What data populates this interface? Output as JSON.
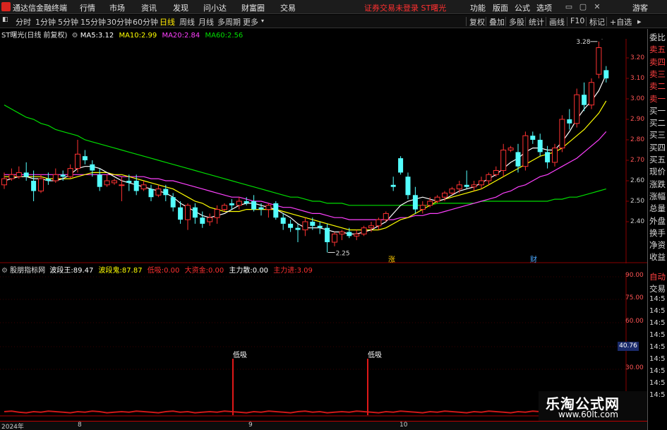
{
  "menubar": {
    "app_name": "通达信金融终端",
    "items": [
      "行情",
      "市场",
      "资讯",
      "发现",
      "问小达",
      "财富圈",
      "交易"
    ],
    "status": "证券交易未登录  ST曙光",
    "right_items": [
      "功能",
      "版面",
      "公式",
      "选项"
    ],
    "guest": "游客"
  },
  "periodbar": {
    "periods": [
      "分时",
      "1分钟",
      "5分钟",
      "15分钟",
      "30分钟",
      "60分钟",
      "日线",
      "周线",
      "月线",
      "多周期",
      "更多"
    ],
    "active": "日线",
    "tools": [
      "复权",
      "叠加",
      "多股",
      "统计",
      "画线",
      "F10",
      "标记",
      "+自选"
    ]
  },
  "main_info": {
    "stock": "ST曙光(日线 前复权)",
    "ma5_label": "MA5:",
    "ma5": "3.12",
    "ma10_label": "MA10:",
    "ma10": "2.99",
    "ma20_label": "MA20:",
    "ma20": "2.84",
    "ma60_label": "MA60:",
    "ma60": "2.56"
  },
  "sub_info": {
    "name": "股朋指标网",
    "f1_label": "波段王:",
    "f1": "89.47",
    "f2_label": "波段鬼:",
    "f2": "87.87",
    "f3_label": "低吸:",
    "f3": "0.00",
    "f4_label": "大资金:",
    "f4": "0.00",
    "f5_label": "主力散:",
    "f5": "0.00",
    "f6_label": "主力进:",
    "f6": "3.09"
  },
  "main_axis": [
    "3.20",
    "3.10",
    "3.00",
    "2.90",
    "2.80",
    "2.70",
    "2.60",
    "2.50",
    "2.40"
  ],
  "sub_axis": [
    "90.00",
    "75.00",
    "60.00",
    "30.00"
  ],
  "sub_marker": "40.76",
  "annotations": {
    "high": "3.28",
    "low": "2.25",
    "tag1": "低吸",
    "tag2": "低吸",
    "flag1": "涨",
    "flag2": "财"
  },
  "dates": [
    "2024年",
    "8",
    "9",
    "10"
  ],
  "right_panel": {
    "items": [
      "委比",
      "卖五",
      "卖四",
      "卖三",
      "卖二",
      "卖一",
      "买一",
      "买二",
      "买三",
      "买四",
      "买五",
      "现价",
      "涨跌",
      "涨幅",
      "总量",
      "外盘",
      "换手",
      "净资",
      "收益"
    ],
    "sub_items": [
      "自动",
      "交易",
      "14:5",
      "14:5",
      "14:5",
      "14:5",
      "14:5",
      "14:5",
      "14:5",
      "14:5",
      "14:5"
    ]
  },
  "watermark": {
    "cn": "乐淘公式网",
    "url": "www.60lt.com"
  },
  "colors": {
    "up": "#ff3232",
    "down": "#54ffff",
    "ma5": "#ffffff",
    "ma10": "#ffff00",
    "ma20": "#ff40ff",
    "ma60": "#00dd00"
  },
  "candles": [
    [
      2.58,
      2.64,
      2.56,
      2.61
    ],
    [
      2.61,
      2.66,
      2.6,
      2.63
    ],
    [
      2.62,
      2.67,
      2.61,
      2.64
    ],
    [
      2.64,
      2.69,
      2.6,
      2.62
    ],
    [
      2.6,
      2.65,
      2.5,
      2.55
    ],
    [
      2.55,
      2.63,
      2.54,
      2.61
    ],
    [
      2.61,
      2.64,
      2.58,
      2.6
    ],
    [
      2.6,
      2.66,
      2.59,
      2.63
    ],
    [
      2.63,
      2.65,
      2.6,
      2.62
    ],
    [
      2.62,
      2.68,
      2.61,
      2.66
    ],
    [
      2.66,
      2.8,
      2.64,
      2.73
    ],
    [
      2.72,
      2.75,
      2.68,
      2.7
    ],
    [
      2.68,
      2.7,
      2.62,
      2.65
    ],
    [
      2.63,
      2.66,
      2.55,
      2.57
    ],
    [
      2.58,
      2.63,
      2.57,
      2.6
    ],
    [
      2.59,
      2.61,
      2.58,
      2.6
    ],
    [
      2.58,
      2.62,
      2.5,
      2.58
    ],
    [
      2.6,
      2.63,
      2.55,
      2.59
    ],
    [
      2.6,
      2.63,
      2.53,
      2.55
    ],
    [
      2.56,
      2.6,
      2.55,
      2.58
    ],
    [
      2.56,
      2.58,
      2.5,
      2.52
    ],
    [
      2.53,
      2.58,
      2.52,
      2.56
    ],
    [
      2.56,
      2.58,
      2.5,
      2.53
    ],
    [
      2.52,
      2.54,
      2.45,
      2.47
    ],
    [
      2.47,
      2.5,
      2.39,
      2.41
    ],
    [
      2.41,
      2.49,
      2.36,
      2.48
    ],
    [
      2.47,
      2.49,
      2.39,
      2.42
    ],
    [
      2.42,
      2.45,
      2.37,
      2.39
    ],
    [
      2.4,
      2.44,
      2.38,
      2.42
    ],
    [
      2.42,
      2.48,
      2.39,
      2.46
    ],
    [
      2.46,
      2.49,
      2.45,
      2.48
    ],
    [
      2.49,
      2.51,
      2.46,
      2.48
    ],
    [
      2.48,
      2.52,
      2.46,
      2.5
    ],
    [
      2.5,
      2.52,
      2.48,
      2.49
    ],
    [
      2.5,
      2.53,
      2.45,
      2.46
    ],
    [
      2.47,
      2.49,
      2.43,
      2.46
    ],
    [
      2.46,
      2.49,
      2.42,
      2.48
    ],
    [
      2.49,
      2.5,
      2.41,
      2.42
    ],
    [
      2.42,
      2.44,
      2.36,
      2.39
    ],
    [
      2.39,
      2.41,
      2.35,
      2.37
    ],
    [
      2.37,
      2.39,
      2.3,
      2.36
    ],
    [
      2.36,
      2.42,
      2.33,
      2.4
    ],
    [
      2.4,
      2.42,
      2.36,
      2.38
    ],
    [
      2.38,
      2.4,
      2.34,
      2.37
    ],
    [
      2.37,
      2.39,
      2.25,
      2.3
    ],
    [
      2.3,
      2.35,
      2.28,
      2.34
    ],
    [
      2.34,
      2.36,
      2.31,
      2.35
    ],
    [
      2.35,
      2.37,
      2.32,
      2.33
    ],
    [
      2.33,
      2.36,
      2.31,
      2.34
    ],
    [
      2.34,
      2.38,
      2.33,
      2.37
    ],
    [
      2.37,
      2.4,
      2.35,
      2.38
    ],
    [
      2.38,
      2.42,
      2.36,
      2.41
    ],
    [
      2.41,
      2.45,
      2.4,
      2.44
    ],
    [
      2.58,
      2.62,
      2.55,
      2.57
    ],
    [
      2.71,
      2.72,
      2.63,
      2.64
    ],
    [
      2.62,
      2.64,
      2.51,
      2.53
    ],
    [
      2.53,
      2.57,
      2.44,
      2.46
    ],
    [
      2.46,
      2.5,
      2.44,
      2.48
    ],
    [
      2.48,
      2.52,
      2.47,
      2.5
    ],
    [
      2.5,
      2.53,
      2.49,
      2.52
    ],
    [
      2.52,
      2.55,
      2.5,
      2.54
    ],
    [
      2.54,
      2.57,
      2.53,
      2.56
    ],
    [
      2.56,
      2.6,
      2.54,
      2.58
    ],
    [
      2.58,
      2.65,
      2.56,
      2.57
    ],
    [
      2.57,
      2.6,
      2.55,
      2.58
    ],
    [
      2.58,
      2.62,
      2.56,
      2.6
    ],
    [
      2.6,
      2.64,
      2.58,
      2.63
    ],
    [
      2.63,
      2.67,
      2.62,
      2.65
    ],
    [
      2.65,
      2.78,
      2.62,
      2.75
    ],
    [
      2.75,
      2.77,
      2.74,
      2.76
    ],
    [
      2.74,
      2.78,
      2.64,
      2.67
    ],
    [
      2.67,
      2.84,
      2.65,
      2.82
    ],
    [
      2.82,
      2.84,
      2.78,
      2.8
    ],
    [
      2.8,
      2.83,
      2.72,
      2.74
    ],
    [
      2.74,
      2.77,
      2.66,
      2.69
    ],
    [
      2.69,
      2.78,
      2.67,
      2.76
    ],
    [
      2.76,
      2.92,
      2.74,
      2.9
    ],
    [
      2.9,
      2.95,
      2.85,
      2.88
    ],
    [
      2.88,
      3.05,
      2.86,
      3.02
    ],
    [
      3.02,
      3.08,
      2.94,
      2.97
    ],
    [
      2.97,
      3.1,
      2.95,
      3.08
    ],
    [
      3.12,
      3.28,
      3.1,
      3.25
    ],
    [
      3.14,
      3.16,
      3.08,
      3.1
    ]
  ],
  "ma_values": {
    "ma5": [
      2.6,
      2.61,
      2.62,
      2.62,
      2.61,
      2.61,
      2.6,
      2.6,
      2.61,
      2.63,
      2.66,
      2.67,
      2.67,
      2.66,
      2.64,
      2.62,
      2.6,
      2.59,
      2.58,
      2.57,
      2.56,
      2.55,
      2.54,
      2.52,
      2.49,
      2.47,
      2.45,
      2.43,
      2.42,
      2.43,
      2.44,
      2.46,
      2.48,
      2.49,
      2.49,
      2.48,
      2.47,
      2.46,
      2.44,
      2.42,
      2.39,
      2.37,
      2.37,
      2.37,
      2.36,
      2.35,
      2.35,
      2.34,
      2.34,
      2.35,
      2.36,
      2.38,
      2.4,
      2.44,
      2.48,
      2.5,
      2.51,
      2.52,
      2.51,
      2.5,
      2.51,
      2.53,
      2.55,
      2.56,
      2.57,
      2.59,
      2.61,
      2.63,
      2.66,
      2.69,
      2.71,
      2.74,
      2.76,
      2.76,
      2.75,
      2.75,
      2.79,
      2.84,
      2.9,
      2.95,
      2.99,
      3.04,
      3.12
    ],
    "ma10": [
      2.62,
      2.62,
      2.62,
      2.62,
      2.62,
      2.62,
      2.61,
      2.61,
      2.61,
      2.61,
      2.62,
      2.63,
      2.64,
      2.64,
      2.64,
      2.63,
      2.63,
      2.62,
      2.61,
      2.6,
      2.59,
      2.58,
      2.57,
      2.56,
      2.54,
      2.52,
      2.5,
      2.49,
      2.47,
      2.46,
      2.45,
      2.45,
      2.45,
      2.46,
      2.46,
      2.46,
      2.46,
      2.46,
      2.45,
      2.44,
      2.43,
      2.42,
      2.41,
      2.4,
      2.39,
      2.38,
      2.37,
      2.36,
      2.36,
      2.36,
      2.36,
      2.36,
      2.37,
      2.39,
      2.41,
      2.42,
      2.44,
      2.46,
      2.48,
      2.5,
      2.51,
      2.52,
      2.53,
      2.54,
      2.55,
      2.56,
      2.58,
      2.6,
      2.62,
      2.64,
      2.66,
      2.68,
      2.7,
      2.72,
      2.73,
      2.74,
      2.76,
      2.79,
      2.82,
      2.85,
      2.89,
      2.93,
      2.99
    ],
    "ma20": [
      2.63,
      2.63,
      2.63,
      2.63,
      2.63,
      2.63,
      2.63,
      2.63,
      2.63,
      2.63,
      2.63,
      2.63,
      2.63,
      2.63,
      2.63,
      2.63,
      2.62,
      2.62,
      2.62,
      2.62,
      2.61,
      2.61,
      2.6,
      2.6,
      2.59,
      2.58,
      2.57,
      2.56,
      2.55,
      2.54,
      2.53,
      2.52,
      2.52,
      2.51,
      2.5,
      2.5,
      2.49,
      2.48,
      2.47,
      2.47,
      2.46,
      2.45,
      2.44,
      2.44,
      2.43,
      2.42,
      2.42,
      2.41,
      2.41,
      2.41,
      2.41,
      2.41,
      2.41,
      2.41,
      2.42,
      2.42,
      2.43,
      2.43,
      2.44,
      2.44,
      2.45,
      2.46,
      2.47,
      2.48,
      2.49,
      2.5,
      2.51,
      2.52,
      2.54,
      2.55,
      2.57,
      2.58,
      2.6,
      2.62,
      2.63,
      2.65,
      2.67,
      2.69,
      2.71,
      2.74,
      2.77,
      2.8,
      2.84
    ],
    "ma60": [
      2.97,
      2.95,
      2.93,
      2.91,
      2.9,
      2.88,
      2.87,
      2.85,
      2.84,
      2.83,
      2.82,
      2.8,
      2.79,
      2.78,
      2.77,
      2.76,
      2.75,
      2.74,
      2.73,
      2.72,
      2.71,
      2.7,
      2.69,
      2.68,
      2.67,
      2.66,
      2.65,
      2.64,
      2.63,
      2.62,
      2.61,
      2.6,
      2.59,
      2.58,
      2.57,
      2.56,
      2.55,
      2.54,
      2.53,
      2.52,
      2.52,
      2.51,
      2.5,
      2.5,
      2.49,
      2.49,
      2.49,
      2.48,
      2.48,
      2.48,
      2.48,
      2.48,
      2.48,
      2.48,
      2.48,
      2.48,
      2.48,
      2.48,
      2.48,
      2.49,
      2.49,
      2.49,
      2.49,
      2.49,
      2.49,
      2.5,
      2.5,
      2.5,
      2.5,
      2.5,
      2.5,
      2.5,
      2.5,
      2.5,
      2.5,
      2.51,
      2.51,
      2.52,
      2.52,
      2.53,
      2.54,
      2.55,
      2.56
    ]
  },
  "sub_red": [
    0.5,
    0.6,
    0.4,
    0.3,
    0.5,
    0.4,
    0.6,
    0.5,
    0.4,
    0.3,
    0.5,
    0.4,
    0.6,
    0.5,
    0.3,
    0.4,
    0.5,
    0.4,
    0.6,
    0.5,
    0.4,
    0.3,
    0.5,
    0.6,
    0.4,
    0.5,
    0.3,
    0.4,
    0.5,
    0.4,
    0.6,
    0.5,
    0.4,
    0.3,
    0.5,
    0.4,
    0.6,
    0.5,
    0.4,
    0.3,
    0.5,
    0.6,
    0.4,
    0.5,
    0.3,
    0.4,
    0.5,
    0.4,
    0.6,
    0.5,
    0.4,
    0.3,
    0.5,
    0.4,
    0.6,
    0.5,
    0.4,
    0.3,
    0.5,
    0.4,
    0.6,
    0.5,
    0.4,
    0.3,
    0.5,
    0.4,
    0.6,
    0.5,
    0.4,
    0.3,
    0.5,
    0.4,
    0.6,
    0.5,
    0.4,
    0.3,
    0.5,
    0.4,
    0.6,
    0.5,
    0.4,
    0.3,
    0.5
  ],
  "sub_spikes": [
    41,
    65
  ]
}
